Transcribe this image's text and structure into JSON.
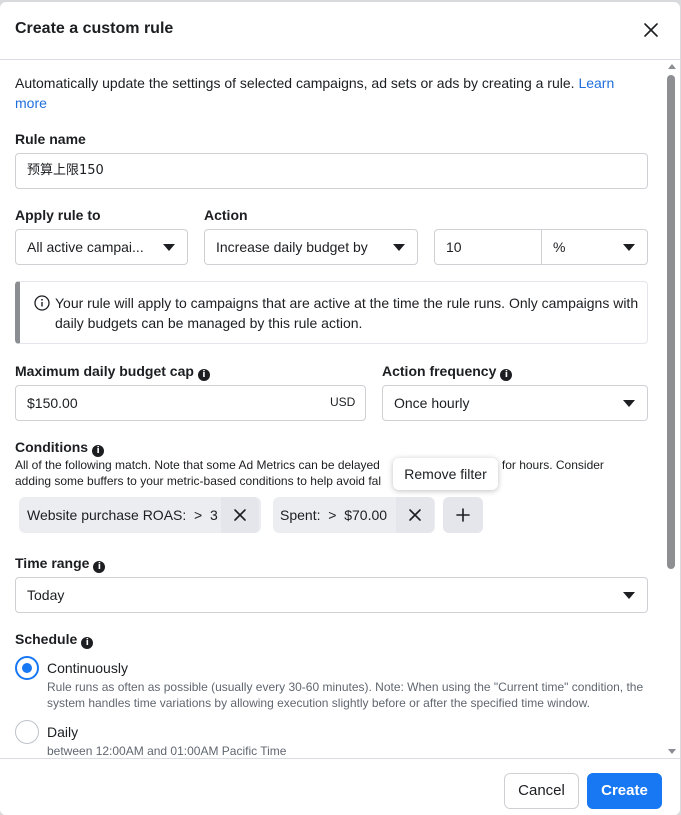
{
  "dialog": {
    "title": "Create a custom rule",
    "intro": "Automatically update the settings of selected campaigns, ad sets or ads by creating a rule.",
    "learn_more": "Learn more",
    "rule_name": {
      "label": "Rule name",
      "value": "预算上限150"
    },
    "apply_rule": {
      "label": "Apply rule to",
      "value": "All active campai..."
    },
    "action": {
      "label": "Action",
      "value": "Increase daily budget by",
      "amount": "10",
      "unit": "%"
    },
    "notice": "Your rule will apply to campaigns that are active at the time the rule runs. Only campaigns with daily budgets can be managed by this rule action.",
    "budget_cap": {
      "label": "Maximum daily budget cap",
      "value": "$150.00",
      "currency": "USD"
    },
    "frequency": {
      "label": "Action frequency",
      "value": "Once hourly"
    },
    "conditions": {
      "label": "Conditions",
      "desc_line1": "All of the following match. Note that some Ad Metrics can be delayed",
      "desc_line1_end": "e for hours. Consider",
      "desc_line2": "adding some buffers to your metric-based conditions to help avoid fal",
      "filters": [
        {
          "metric": "Website purchase ROAS:",
          "op": ">",
          "value": "3"
        },
        {
          "metric": "Spent:",
          "op": ">",
          "value": "$70.00"
        }
      ],
      "tooltip": "Remove filter"
    },
    "time_range": {
      "label": "Time range",
      "value": "Today"
    },
    "schedule": {
      "label": "Schedule",
      "options": [
        {
          "title": "Continuously",
          "desc": "Rule runs as often as possible (usually every 30-60 minutes). Note: When using the \"Current time\" condition, the system handles time variations by allowing execution slightly before or after the specified time window.",
          "selected": true
        },
        {
          "title": "Daily",
          "desc": "between 12:00AM and 01:00AM Pacific Time",
          "selected": false
        }
      ]
    },
    "buttons": {
      "cancel": "Cancel",
      "create": "Create"
    },
    "colors": {
      "primary": "#1877f2",
      "link": "#216fdb"
    }
  }
}
